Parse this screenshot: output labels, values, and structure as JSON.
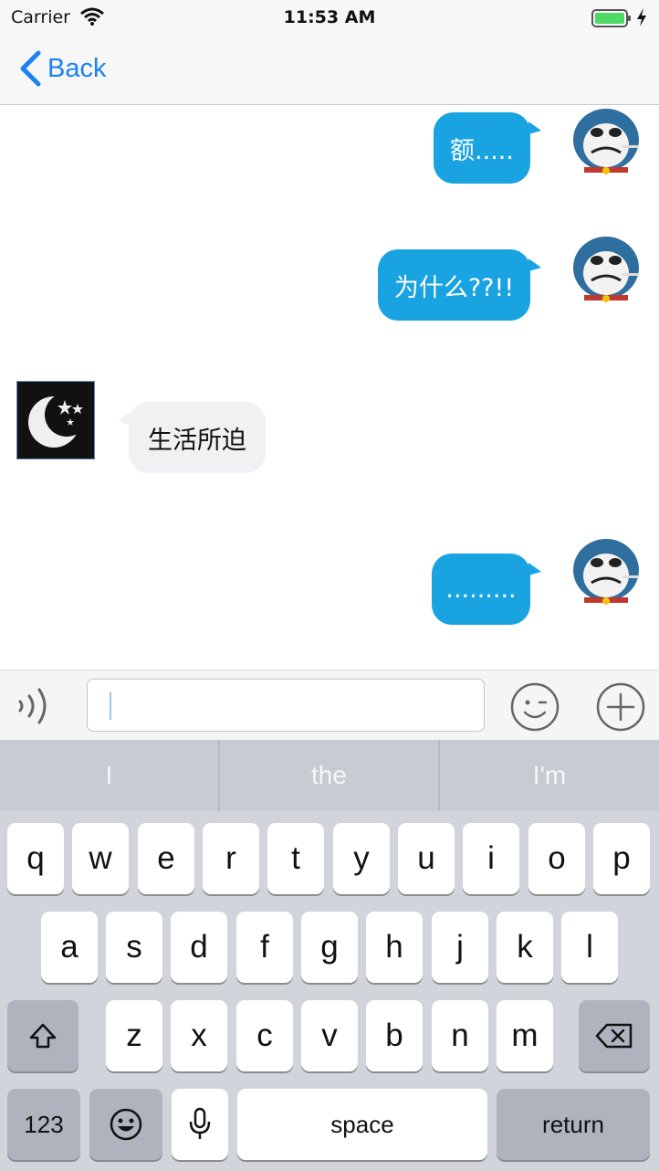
{
  "status_bar": {
    "carrier": "Carrier",
    "time": "11:53 AM"
  },
  "nav": {
    "back_label": "Back"
  },
  "messages": [
    {
      "side": "out",
      "text": "额....."
    },
    {
      "side": "out",
      "text": "为什么??!!"
    },
    {
      "side": "in",
      "text": "生活所迫"
    },
    {
      "side": "out",
      "text": "........."
    }
  ],
  "input": {
    "value": ""
  },
  "keyboard": {
    "suggestions": [
      "I",
      "the",
      "I'm"
    ],
    "row1": [
      "q",
      "w",
      "e",
      "r",
      "t",
      "y",
      "u",
      "i",
      "o",
      "p"
    ],
    "row2": [
      "a",
      "s",
      "d",
      "f",
      "g",
      "h",
      "j",
      "k",
      "l"
    ],
    "row3": [
      "z",
      "x",
      "c",
      "v",
      "b",
      "n",
      "m"
    ],
    "numbers_label": "123",
    "space_label": "space",
    "return_label": "return"
  },
  "colors": {
    "accent": "#1a82f6",
    "outgoing_bubble": "#19a3e0",
    "incoming_bubble": "#f1f1f3",
    "keyboard_bg": "#d1d4da"
  }
}
